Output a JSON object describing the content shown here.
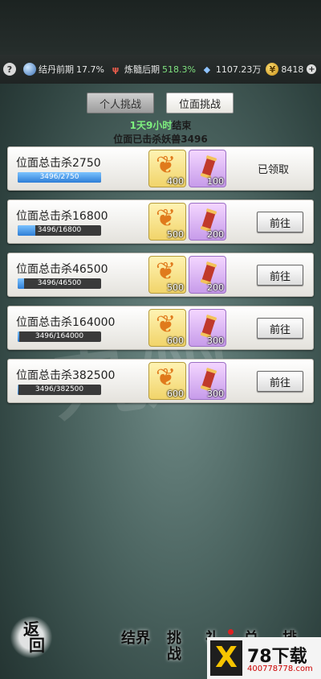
{
  "resources": {
    "help": "?",
    "realm": "结丹前期",
    "realm_pct": "17.7%",
    "stage": "炼髓后期",
    "stage_pct": "518.3%",
    "crystals": "1107.23万",
    "coins": "8418",
    "plus": "+"
  },
  "tabs": [
    {
      "label": "个人挑战",
      "active": false
    },
    {
      "label": "位面挑战",
      "active": true
    }
  ],
  "timer": {
    "value": "1天9小时",
    "suffix": "结束"
  },
  "kills_text": "位面已击杀妖兽3496",
  "tasks": [
    {
      "title": "位面总击杀2750",
      "progress_text": "3496/2750",
      "progress": 1.0,
      "gold_amount": "400",
      "purple_amount": "100",
      "action": "已领取",
      "claimed": true
    },
    {
      "title": "位面总击杀16800",
      "progress_text": "3496/16800",
      "progress": 0.208,
      "gold_amount": "500",
      "purple_amount": "200",
      "action": "前往",
      "claimed": false
    },
    {
      "title": "位面总击杀46500",
      "progress_text": "3496/46500",
      "progress": 0.075,
      "gold_amount": "500",
      "purple_amount": "200",
      "action": "前往",
      "claimed": false
    },
    {
      "title": "位面总击杀164000",
      "progress_text": "3496/164000",
      "progress": 0.021,
      "gold_amount": "600",
      "purple_amount": "300",
      "action": "前往",
      "claimed": false
    },
    {
      "title": "位面总击杀382500",
      "progress_text": "3496/382500",
      "progress": 0.009,
      "gold_amount": "600",
      "purple_amount": "300",
      "action": "前往",
      "claimed": false
    }
  ],
  "bottom_nav": {
    "back": [
      "返",
      "回"
    ],
    "items": [
      {
        "label": [
          "结",
          "界"
        ]
      },
      {
        "label": [
          "挑",
          "战"
        ]
      },
      {
        "label": [
          "礼",
          ""
        ]
      },
      {
        "label": [
          "兑",
          ""
        ]
      },
      {
        "label": [
          "排",
          ""
        ]
      }
    ]
  },
  "logo": {
    "mark": "X",
    "name": "78下载",
    "url": "400778778.com"
  },
  "colors": {
    "accent_green": "#7ef07e",
    "progress_blue": "#2e7ed6",
    "reward_gold": "#f1d46a",
    "reward_purple": "#c79bea"
  }
}
